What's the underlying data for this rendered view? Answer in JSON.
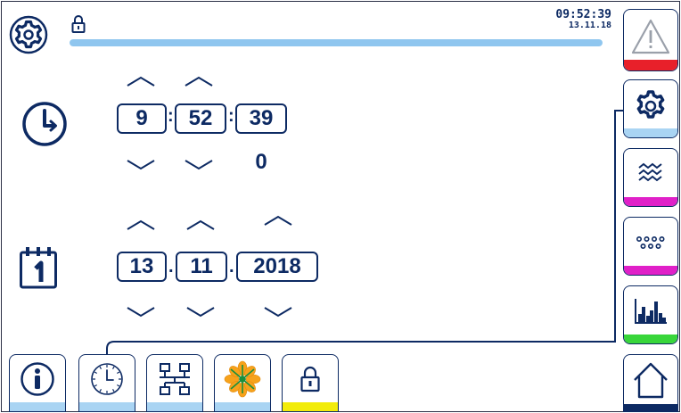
{
  "status": {
    "time": "09:52:39",
    "date": "13.11.18",
    "progress": 1.0
  },
  "time_editor": {
    "hours": "9",
    "minutes": "52",
    "seconds": "39",
    "subseconds": "0",
    "separator": ":"
  },
  "date_editor": {
    "day": "13",
    "month": "11",
    "year": "2018",
    "separator": "."
  },
  "right_menu": [
    {
      "icon": "warning-icon",
      "accent": "#e8202a"
    },
    {
      "icon": "gear-icon",
      "accent": "#a9d4f3",
      "selected": true
    },
    {
      "icon": "waves-icon",
      "accent": "#e020c8"
    },
    {
      "icon": "dots-icon",
      "accent": "#e020c8"
    },
    {
      "icon": "bar-chart-icon",
      "accent": "#38d63a"
    },
    {
      "icon": "home-icon",
      "accent": "#0d2a63"
    }
  ],
  "bottom_menu": [
    {
      "icon": "info-icon",
      "accent": "#a9d4f3"
    },
    {
      "icon": "clock-icon",
      "accent": "#a9d4f3",
      "selected": true
    },
    {
      "icon": "network-icon",
      "accent": "#a9d4f3"
    },
    {
      "icon": "flower-icon",
      "accent": "#a9d4f3"
    },
    {
      "icon": "lock-icon",
      "accent": "#f2ec0a"
    }
  ],
  "colors": {
    "primary": "#0d2a63",
    "progress": "#8fc6ef",
    "tab_selected": "#a9d4f3"
  }
}
